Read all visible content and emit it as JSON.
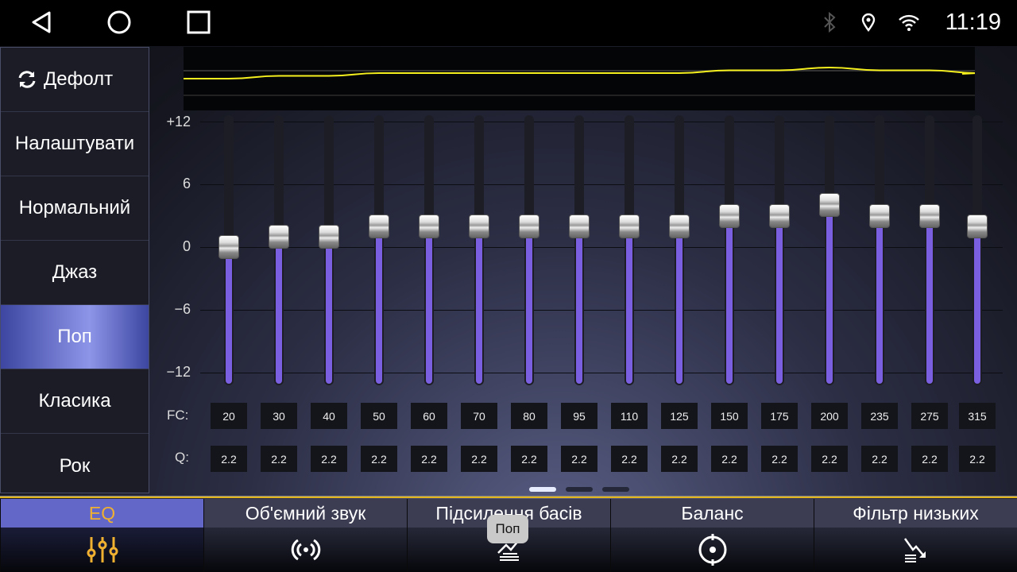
{
  "status": {
    "time": "11:19",
    "icons": [
      "bluetooth-icon",
      "location-icon",
      "wifi-icon"
    ]
  },
  "nav": [
    "back-icon",
    "home-icon",
    "recents-icon"
  ],
  "sidebar": {
    "items": [
      {
        "label": "Дефолт",
        "icon": "refresh-icon"
      },
      {
        "label": "Налаштувати"
      },
      {
        "label": "Нормальний"
      },
      {
        "label": "Джаз"
      },
      {
        "label": "Поп",
        "active": true
      },
      {
        "label": "Класика"
      },
      {
        "label": "Рок"
      }
    ]
  },
  "eq": {
    "scale": [
      "+12",
      "6",
      "0",
      "−6",
      "−12"
    ],
    "range": [
      -12,
      12
    ],
    "fc_label": "FC:",
    "q_label": "Q:",
    "fc": [
      "20",
      "30",
      "40",
      "50",
      "60",
      "70",
      "80",
      "95",
      "110",
      "125",
      "150",
      "175",
      "200",
      "235",
      "275",
      "315"
    ],
    "q": [
      "2.2",
      "2.2",
      "2.2",
      "2.2",
      "2.2",
      "2.2",
      "2.2",
      "2.2",
      "2.2",
      "2.2",
      "2.2",
      "2.2",
      "2.2",
      "2.2",
      "2.2",
      "2.2"
    ],
    "gains": [
      0,
      1,
      1,
      2,
      2,
      2,
      2,
      2,
      2,
      2,
      3,
      3,
      4,
      3,
      3,
      2
    ],
    "curve_color": "#f5f01e",
    "fill_color": "#7a5fe0"
  },
  "pager": {
    "pages": 3,
    "current": 0
  },
  "tabs": [
    {
      "label": "EQ",
      "icon": "equalizer-icon",
      "active": true
    },
    {
      "label": "Об'ємний звук",
      "icon": "surround-icon"
    },
    {
      "label": "Підсилення басів",
      "icon": "bass-boost-icon"
    },
    {
      "label": "Баланс",
      "icon": "balance-icon"
    },
    {
      "label": "Фільтр низьких",
      "icon": "lowpass-filter-icon"
    }
  ],
  "toast": "Поп",
  "accent": "#e3b51c"
}
